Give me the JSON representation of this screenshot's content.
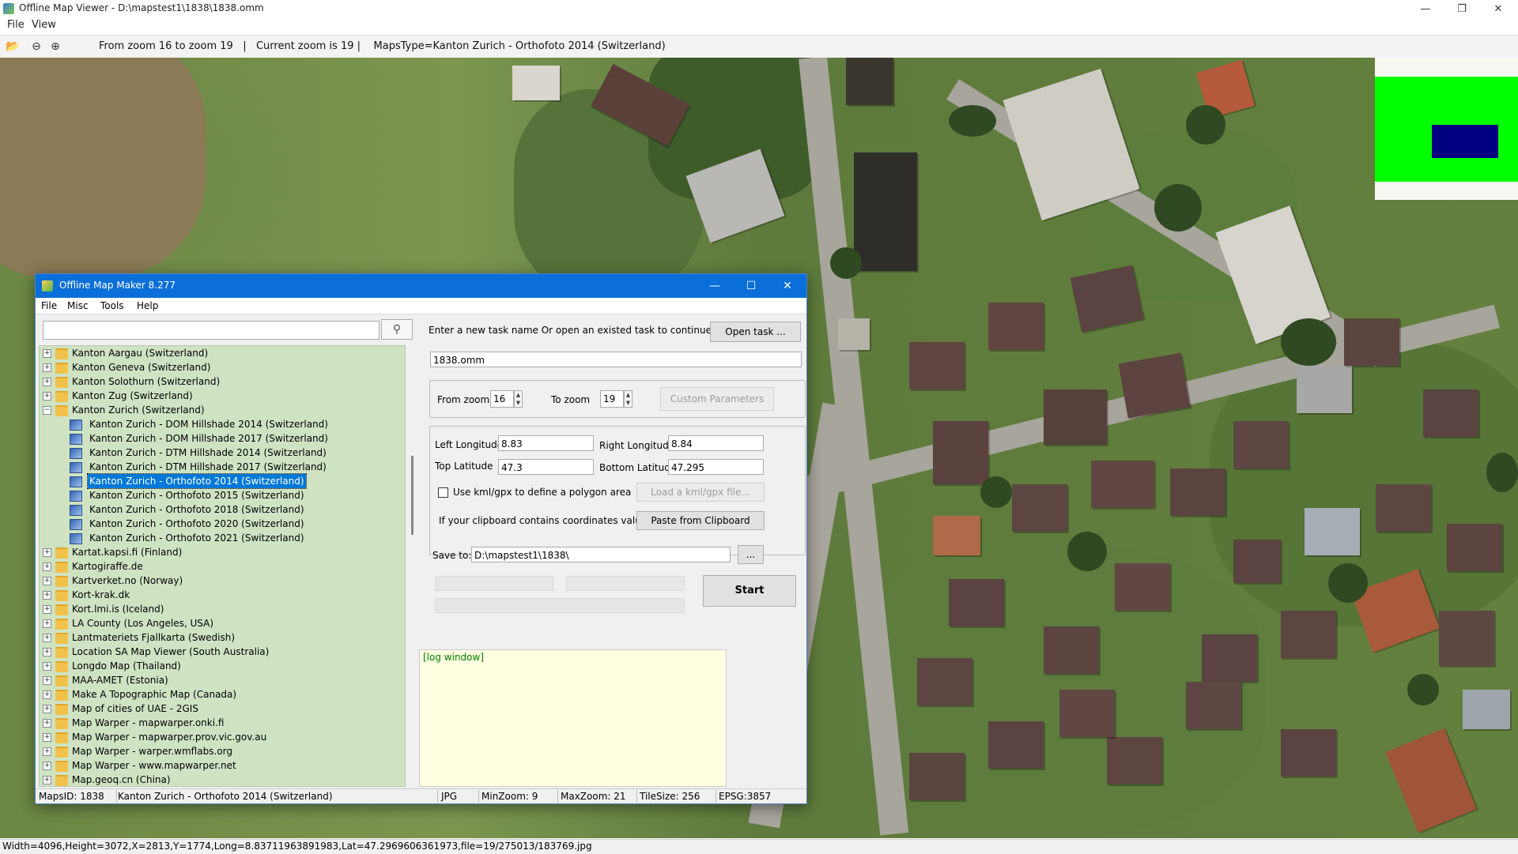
{
  "window": {
    "title": "Offline Map Viewer - D:\\mapstest1\\1838\\1838.omm",
    "menu": [
      "File",
      "View"
    ]
  },
  "toolbar": {
    "icons": [
      "folder-open-icon",
      "zoom-out-icon",
      "zoom-in-icon"
    ],
    "info": "From zoom 16 to zoom 19   |   Current zoom is 19 |    MapsType=Kanton Zurich - Orthofoto 2014 (Switzerland)"
  },
  "colors": {
    "dialog_title": "#0a6fd8",
    "tree_background": "#cfe3c3",
    "log_background": "#ffffe1",
    "overview_area": "#00ff00",
    "overview_view": "#000080"
  },
  "statusbar": {
    "text": "Width=4096,Height=3072,X=2813,Y=1774,Long=8.83711963891983,Lat=47.2969606361973,file=19/275013/183769.jpg"
  },
  "dialog": {
    "title": "Offline Map Maker 8.277",
    "menu": [
      "File",
      "Misc",
      "Tools",
      "Help"
    ],
    "search": {
      "value": "",
      "placeholder": ""
    },
    "tree": {
      "items": [
        {
          "label": "Kanton Aargau (Switzerland)",
          "expander": "+"
        },
        {
          "label": "Kanton Geneva (Switzerland)",
          "expander": "+"
        },
        {
          "label": "Kanton Solothurn (Switzerland)",
          "expander": "+"
        },
        {
          "label": "Kanton Zug (Switzerland)",
          "expander": "+"
        },
        {
          "label": "Kanton Zurich (Switzerland)",
          "expander": "−"
        },
        {
          "label": "Kanton Zurich - DOM Hillshade 2014 (Switzerland)",
          "child": true
        },
        {
          "label": "Kanton Zurich - DOM Hillshade 2017 (Switzerland)",
          "child": true
        },
        {
          "label": "Kanton Zurich - DTM Hillshade 2014 (Switzerland)",
          "child": true
        },
        {
          "label": "Kanton Zurich - DTM Hillshade 2017 (Switzerland)",
          "child": true
        },
        {
          "label": "Kanton Zurich - Orthofoto 2014 (Switzerland)",
          "child": true,
          "selected": true
        },
        {
          "label": "Kanton Zurich - Orthofoto 2015 (Switzerland)",
          "child": true
        },
        {
          "label": "Kanton Zurich - Orthofoto 2018 (Switzerland)",
          "child": true
        },
        {
          "label": "Kanton Zurich - Orthofoto 2020 (Switzerland)",
          "child": true
        },
        {
          "label": "Kanton Zurich - Orthofoto 2021 (Switzerland)",
          "child": true
        },
        {
          "label": "Kartat.kapsi.fi (Finland)",
          "expander": "+"
        },
        {
          "label": "Kartogiraffe.de",
          "expander": "+"
        },
        {
          "label": "Kartverket.no (Norway)",
          "expander": "+"
        },
        {
          "label": "Kort-krak.dk",
          "expander": "+"
        },
        {
          "label": "Kort.lmi.is (Iceland)",
          "expander": "+"
        },
        {
          "label": "LA County (Los Angeles, USA)",
          "expander": "+"
        },
        {
          "label": "Lantmateriets Fjallkarta (Swedish)",
          "expander": "+"
        },
        {
          "label": "Location SA Map Viewer (South Australia)",
          "expander": "+"
        },
        {
          "label": "Longdo Map (Thailand)",
          "expander": "+"
        },
        {
          "label": "MAA-AMET (Estonia)",
          "expander": "+"
        },
        {
          "label": "Make A Topographic Map (Canada)",
          "expander": "+"
        },
        {
          "label": "Map of cities of UAE - 2GIS",
          "expander": "+"
        },
        {
          "label": "Map Warper - mapwarper.onki.fi",
          "expander": "+"
        },
        {
          "label": "Map Warper - mapwarper.prov.vic.gov.au",
          "expander": "+"
        },
        {
          "label": "Map Warper - warper.wmflabs.org",
          "expander": "+"
        },
        {
          "label": "Map Warper - www.mapwarper.net",
          "expander": "+"
        },
        {
          "label": "Map.geoq.cn (China)",
          "expander": "+"
        }
      ]
    },
    "task": {
      "prompt": "Enter a new task name Or open an existed task to continue:",
      "open_button": "Open task ...",
      "name": "1838.omm"
    },
    "zoom": {
      "from_label": "From zoom",
      "from_value": "16",
      "to_label": "To zoom",
      "to_value": "19",
      "custom_button": "Custom Parameters"
    },
    "coords": {
      "left_label": "Left Longitude",
      "left_value": "8.83",
      "right_label": "Right Longitude",
      "right_value": "8.84",
      "top_label": "Top Latitude",
      "top_value": "47.3",
      "bottom_label": "Bottom Latitude",
      "bottom_value": "47.295",
      "kml_label": "Use kml/gpx to define a polygon area",
      "kml_checked": false,
      "kml_button": "Load a kml/gpx file...",
      "clipboard_label": "If your clipboard contains coordinates values:",
      "clipboard_button": "Paste from Clipboard"
    },
    "save": {
      "label": "Save to:",
      "path": "D:\\mapstest1\\1838\\",
      "browse_button": "...",
      "start_button": "Start"
    },
    "log": {
      "text": "[log window]"
    },
    "status": {
      "maps_id": "MapsID: 1838",
      "maps_name": "Kanton Zurich - Orthofoto 2014 (Switzerland)",
      "format": "JPG",
      "min_zoom": "MinZoom: 9",
      "max_zoom": "MaxZoom: 21",
      "tile_size": "TileSize: 256",
      "epsg": "EPSG:3857"
    }
  }
}
